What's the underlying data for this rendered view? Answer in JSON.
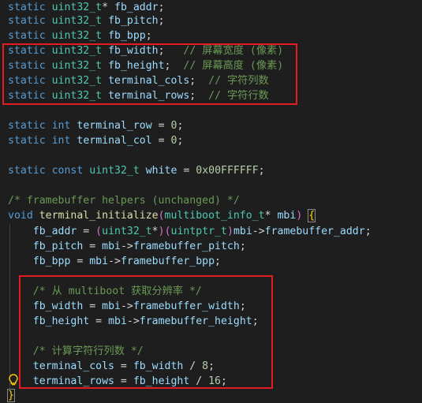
{
  "colors": {
    "background": "#1e1e1e",
    "keyword": "#569cd6",
    "type": "#4ec9b0",
    "variable": "#9cdcfe",
    "function": "#dcdcaa",
    "number": "#b5cea8",
    "comment": "#6a9955",
    "highlight_box": "#e51c23"
  },
  "icons": {
    "lightbulb": "lightbulb-icon"
  },
  "code": {
    "l1": {
      "kw": "static",
      "type": "uint32_t",
      "star": "*",
      "name": "fb_addr",
      "end": ";"
    },
    "l2": {
      "kw": "static",
      "type": "uint32_t",
      "name": "fb_pitch",
      "end": ";"
    },
    "l3": {
      "kw": "static",
      "type": "uint32_t",
      "name": "fb_bpp",
      "end": ";"
    },
    "l4": {
      "kw": "static",
      "type": "uint32_t",
      "name": "fb_width",
      "end": ";",
      "comment": "// 屏幕宽度 (像素)"
    },
    "l5": {
      "kw": "static",
      "type": "uint32_t",
      "name": "fb_height",
      "end": ";",
      "comment": "// 屏幕高度 (像素)"
    },
    "l6": {
      "kw": "static",
      "type": "uint32_t",
      "name": "terminal_cols",
      "end": ";",
      "comment": "// 字符列数"
    },
    "l7": {
      "kw": "static",
      "type": "uint32_t",
      "name": "terminal_rows",
      "end": ";",
      "comment": "// 字符行数"
    },
    "l9": {
      "kw": "static",
      "type": "int",
      "name": "terminal_row",
      "eq": " = ",
      "val": "0",
      "end": ";"
    },
    "l10": {
      "kw": "static",
      "type": "int",
      "name": "terminal_col",
      "eq": " = ",
      "val": "0",
      "end": ";"
    },
    "l12": {
      "kw": "static",
      "kw2": "const",
      "type": "uint32_t",
      "name": "white",
      "eq": " = ",
      "val": "0x00FFFFFF",
      "end": ";"
    },
    "l14": {
      "comment": "/* framebuffer helpers (unchanged) */"
    },
    "l15": {
      "kw": "void",
      "fn": "terminal_initialize",
      "lparen": "(",
      "type": "multiboot_info_t",
      "star": "*",
      "param": "mbi",
      "rparen": ")",
      "brace": "{"
    },
    "l16": {
      "lhs": "fb_addr",
      "eq": " = ",
      "cast_open": "(",
      "type1": "uint32_t",
      "star": "*",
      "cast_close": ")",
      "cast2_open": "(",
      "type2": "uintptr_t",
      "cast2_close": ")",
      "obj": "mbi",
      "arrow": "->",
      "field": "framebuffer_addr",
      "end": ";"
    },
    "l17": {
      "lhs": "fb_pitch",
      "eq": " = ",
      "obj": "mbi",
      "arrow": "->",
      "field": "framebuffer_pitch",
      "end": ";"
    },
    "l18": {
      "lhs": "fb_bpp",
      "eq": " = ",
      "obj": "mbi",
      "arrow": "->",
      "field": "framebuffer_bpp",
      "end": ";"
    },
    "l20": {
      "comment": "/* 从 multiboot 获取分辨率 */"
    },
    "l21": {
      "lhs": "fb_width",
      "eq": " = ",
      "obj": "mbi",
      "arrow": "->",
      "field": "framebuffer_width",
      "end": ";"
    },
    "l22": {
      "lhs": "fb_height",
      "eq": " = ",
      "obj": "mbi",
      "arrow": "->",
      "field": "framebuffer_height",
      "end": ";"
    },
    "l24": {
      "comment": "/* 计算字符行列数 */"
    },
    "l25": {
      "lhs": "terminal_cols",
      "eq": " = ",
      "rhs": "fb_width",
      "op": " / ",
      "val": "8",
      "end": ";"
    },
    "l26": {
      "lhs": "terminal_rows",
      "eq": " = ",
      "rhs": "fb_height",
      "op": " / ",
      "val": "16",
      "end": ";"
    },
    "l27": {
      "brace": "}"
    }
  }
}
